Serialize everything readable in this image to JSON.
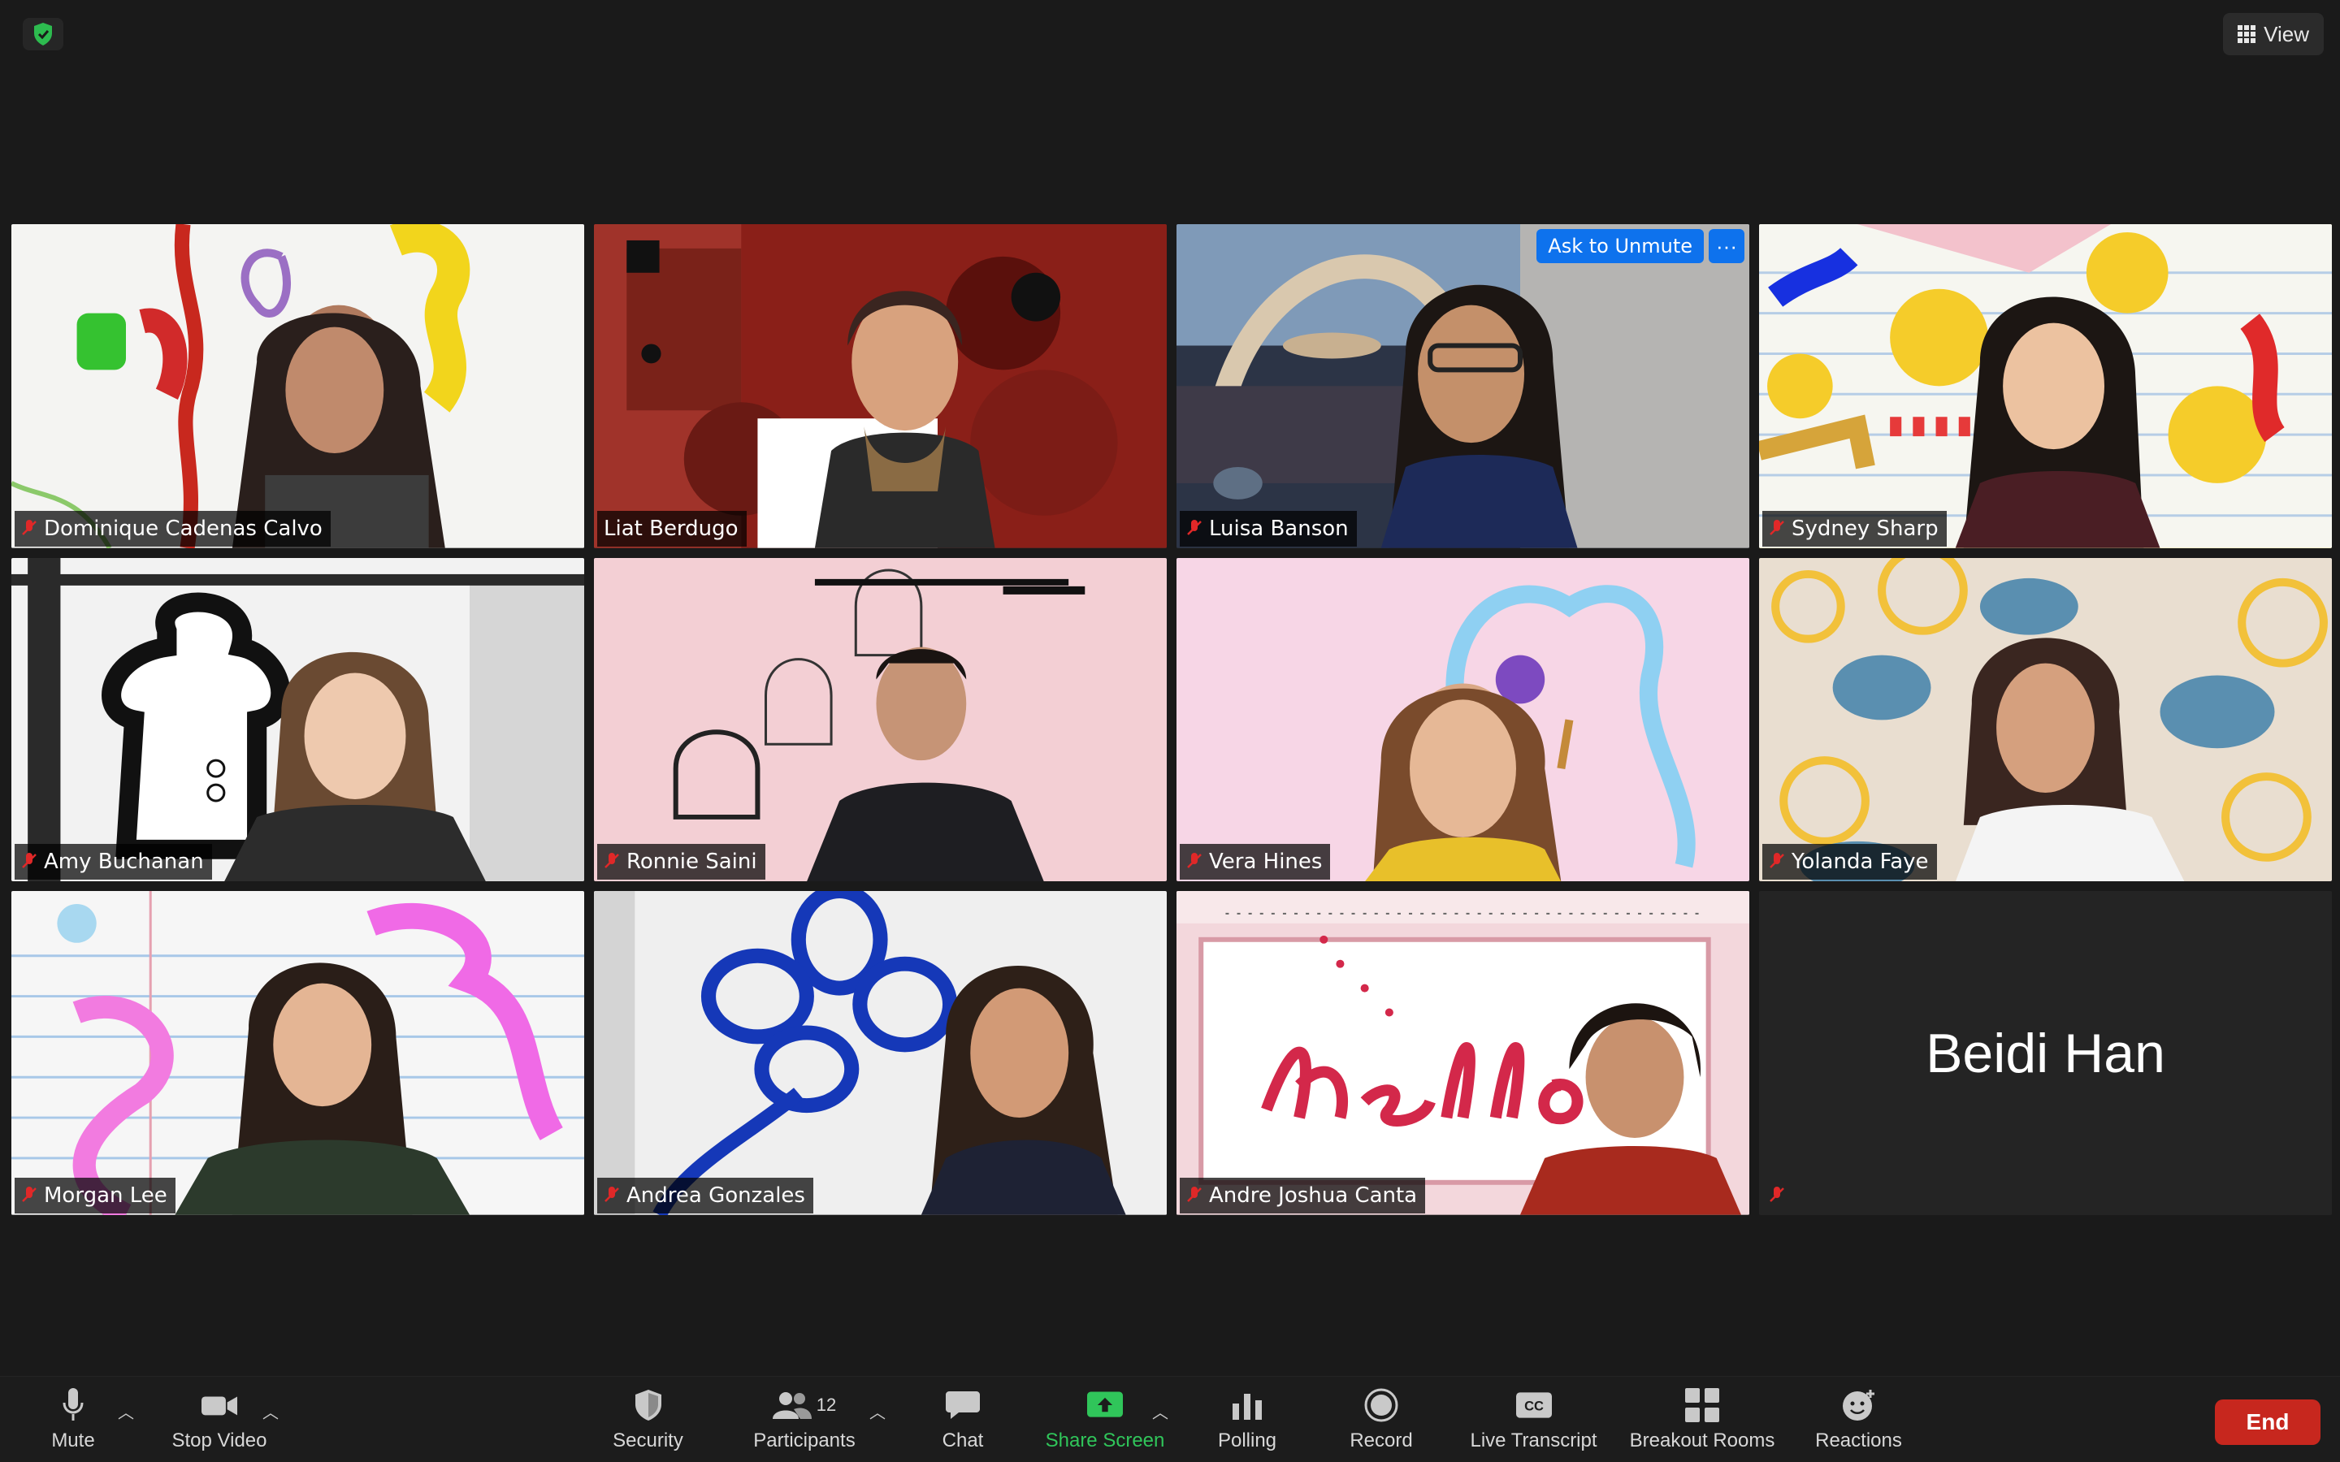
{
  "top": {
    "view_label": "View"
  },
  "tiles": [
    {
      "name": "Dominique Cadenas Calvo"
    },
    {
      "name": "Liat Berdugo"
    },
    {
      "name": "Luisa Banson"
    },
    {
      "name": "Sydney Sharp"
    },
    {
      "name": "Amy Buchanan"
    },
    {
      "name": "Ronnie Saini"
    },
    {
      "name": "Vera Hines"
    },
    {
      "name": "Yolanda Faye"
    },
    {
      "name": "Morgan Lee"
    },
    {
      "name": "Andrea Gonzales"
    },
    {
      "name": "Andre Joshua Canta"
    },
    {
      "name": "Beidi Han"
    }
  ],
  "ask_to_unmute": "Ask to Unmute",
  "more_label": "···",
  "toolbar": {
    "mute": "Mute",
    "stop_video": "Stop Video",
    "security": "Security",
    "participants": "Participants",
    "participants_count": "12",
    "chat": "Chat",
    "share_screen": "Share Screen",
    "polling": "Polling",
    "record": "Record",
    "live_transcript": "Live Transcript",
    "breakout_rooms": "Breakout Rooms",
    "reactions": "Reactions",
    "end": "End"
  },
  "colors": {
    "share_green": "#30c55a",
    "end_red": "#c7271e",
    "unmute_blue": "#0e72ed",
    "active_border": "#f0e68a"
  }
}
